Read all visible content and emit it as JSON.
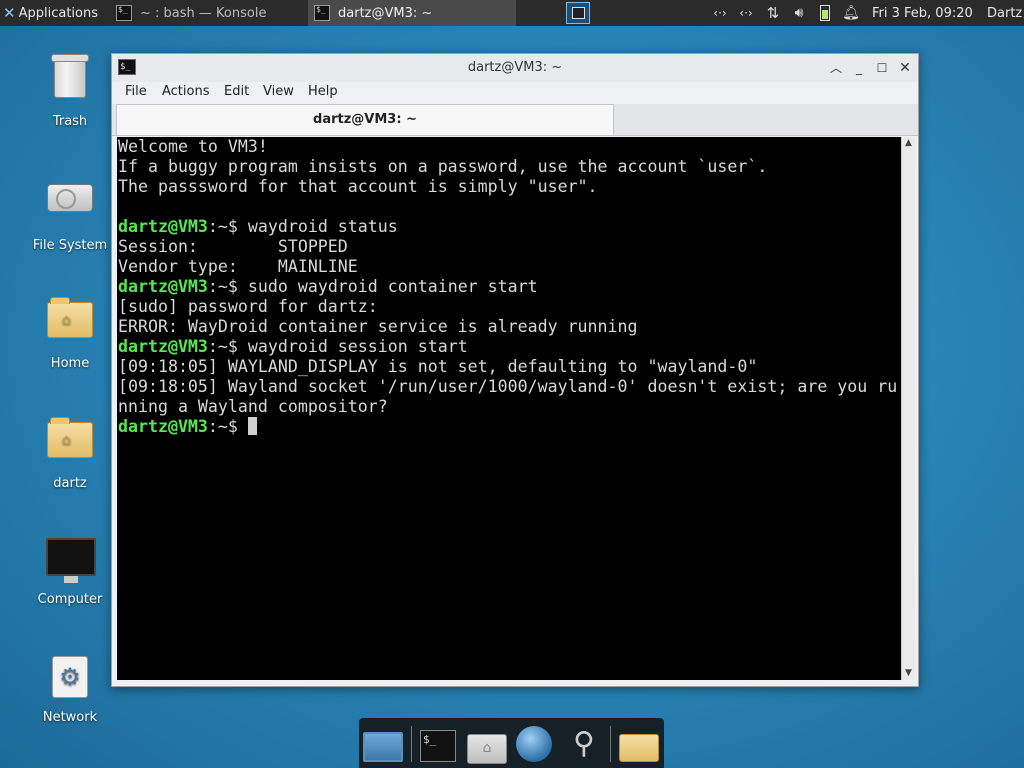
{
  "top_panel": {
    "applications_label": "Applications",
    "tasks": [
      {
        "label": "~ : bash — Konsole",
        "icon": "terminal-icon"
      },
      {
        "label": "dartz@VM3: ~",
        "icon": "terminal-icon"
      }
    ],
    "clock": "Fri  3 Feb, 09:20",
    "user": "Dartz",
    "tray_icons": [
      "network-icon",
      "network-icon",
      "transfer-icon",
      "volume-icon",
      "battery-icon",
      "notification-bell-icon"
    ]
  },
  "desktop_icons": [
    {
      "label": "Trash",
      "icon": "trash-icon"
    },
    {
      "label": "File System",
      "icon": "drive-icon"
    },
    {
      "label": "Home",
      "icon": "home-folder-icon"
    },
    {
      "label": "dartz",
      "icon": "home-folder-icon"
    },
    {
      "label": "Computer",
      "icon": "monitor-icon"
    },
    {
      "label": "Network",
      "icon": "network-settings-icon"
    }
  ],
  "window": {
    "title": "dartz@VM3: ~",
    "menu": [
      "File",
      "Actions",
      "Edit",
      "View",
      "Help"
    ],
    "tab_label": "dartz@VM3: ~",
    "prompt_user": "dartz@VM3",
    "prompt_path": ":~$",
    "terminal_lines": [
      "Welcome to VM3!",
      "If a buggy program insists on a password, use the account `user`.",
      "The passsword for that account is simply \"user\".",
      "",
      "Session:        STOPPED",
      "Vendor type:    MAINLINE",
      "[sudo] password for dartz:",
      "ERROR: WayDroid container service is already running",
      "[09:18:05] WAYLAND_DISPLAY is not set, defaulting to \"wayland-0\"",
      "[09:18:05] Wayland socket '/run/user/1000/wayland-0' doesn't exist; are you ru",
      "nning a Wayland compositor?"
    ],
    "commands": [
      " waydroid status",
      " sudo waydroid container start",
      " waydroid session start",
      " "
    ]
  },
  "dock_items": [
    "show-desktop-icon",
    "terminal-icon",
    "home-folder-icon",
    "web-browser-icon",
    "search-icon",
    "folder-icon"
  ]
}
